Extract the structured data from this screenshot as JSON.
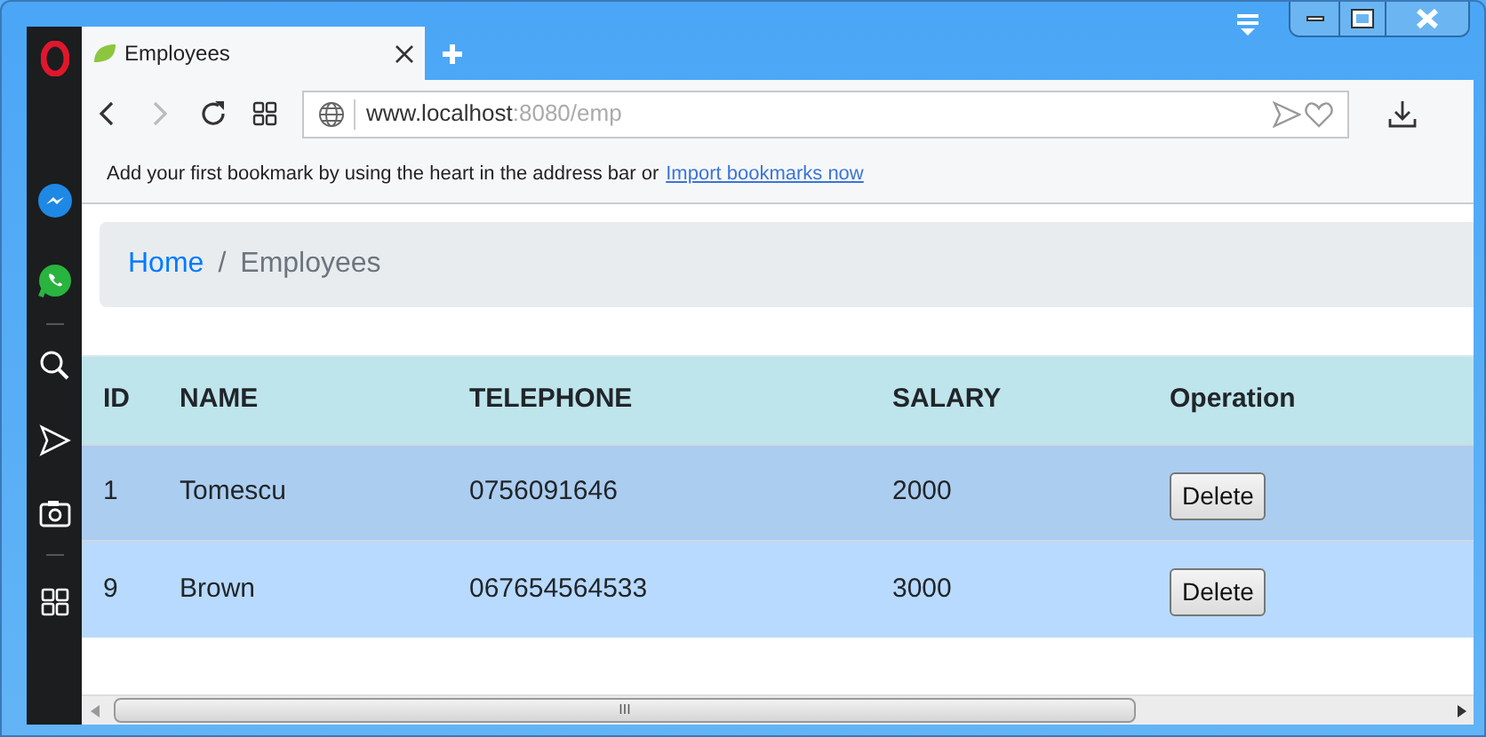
{
  "tab": {
    "title": "Employees"
  },
  "address_bar": {
    "host": "www.localhost",
    "rest": ":8080/emp"
  },
  "bookmarks_bar": {
    "text": "Add your first bookmark by using the heart in the address bar or",
    "link": "Import bookmarks now"
  },
  "breadcrumb": [
    {
      "label": "Home",
      "kind": "link"
    },
    {
      "label": "/",
      "kind": "separator"
    },
    {
      "label": "Employees",
      "kind": "current"
    }
  ],
  "table": {
    "columns": [
      "ID",
      "NAME",
      "TELEPHONE",
      "SALARY",
      "Operation"
    ],
    "rows": [
      {
        "cells": [
          "1",
          "Tomescu",
          "0756091646",
          "2000"
        ],
        "button": "Delete",
        "color": "#abcdf0"
      },
      {
        "cells": [
          "9",
          "Brown",
          "067654564533",
          "3000"
        ],
        "button": "Delete",
        "color": "#b8daff"
      }
    ]
  },
  "scrollbar_grip": "III"
}
